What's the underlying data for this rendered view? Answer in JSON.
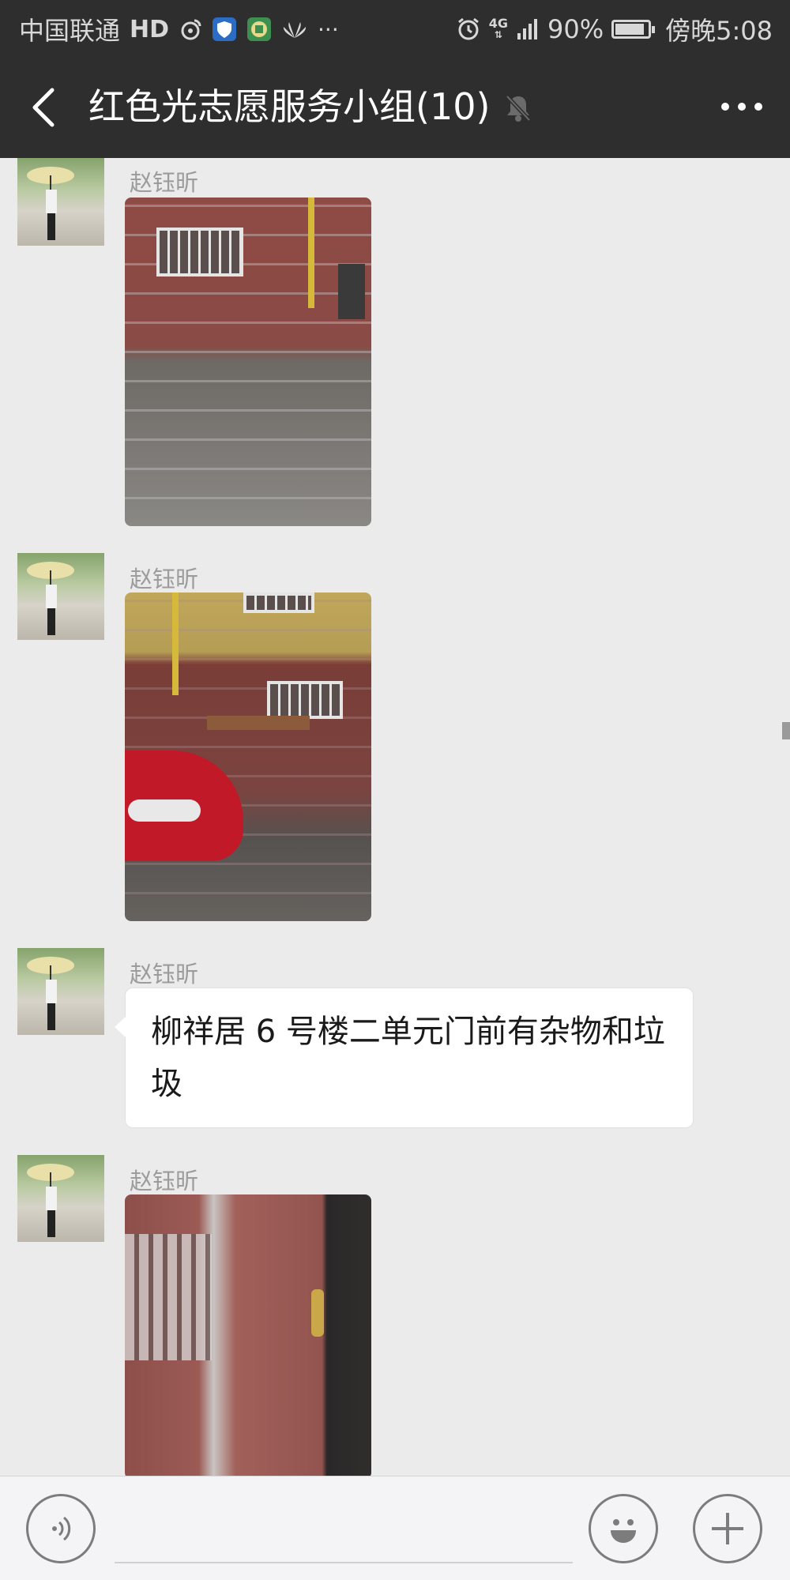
{
  "status_bar": {
    "carrier": "中国联通",
    "hd_label": "HD",
    "network_label": "4G",
    "battery_percent": "90%",
    "battery_level": 0.9,
    "time": "傍晚5:08",
    "icons": [
      "weibo-icon",
      "shield-app-icon",
      "green-app-icon",
      "huawei-icon",
      "more-dots-icon",
      "alarm-icon",
      "signal-icon",
      "battery-icon"
    ]
  },
  "title_bar": {
    "title": "红色光志愿服务小组(10)",
    "back_icon": "chevron-left-icon",
    "mute_icon": "bell-muted-icon",
    "more_icon": "more-horizontal-icon"
  },
  "messages": [
    {
      "sender": "赵钰昕",
      "type": "image"
    },
    {
      "sender": "赵钰昕",
      "type": "image"
    },
    {
      "sender": "赵钰昕",
      "type": "text",
      "text": "柳祥居 6 号楼二单元门前有杂物和垃圾"
    },
    {
      "sender": "赵钰昕",
      "type": "image"
    }
  ],
  "input_bar": {
    "voice_icon": "voice-icon",
    "emoji_icon": "emoji-icon",
    "plus_icon": "plus-icon",
    "placeholder": ""
  },
  "colors": {
    "header_bg": "#2e2e2e",
    "chat_bg": "#ebebeb",
    "bubble_bg": "#ffffff",
    "sender_text": "#9c9c9c"
  }
}
